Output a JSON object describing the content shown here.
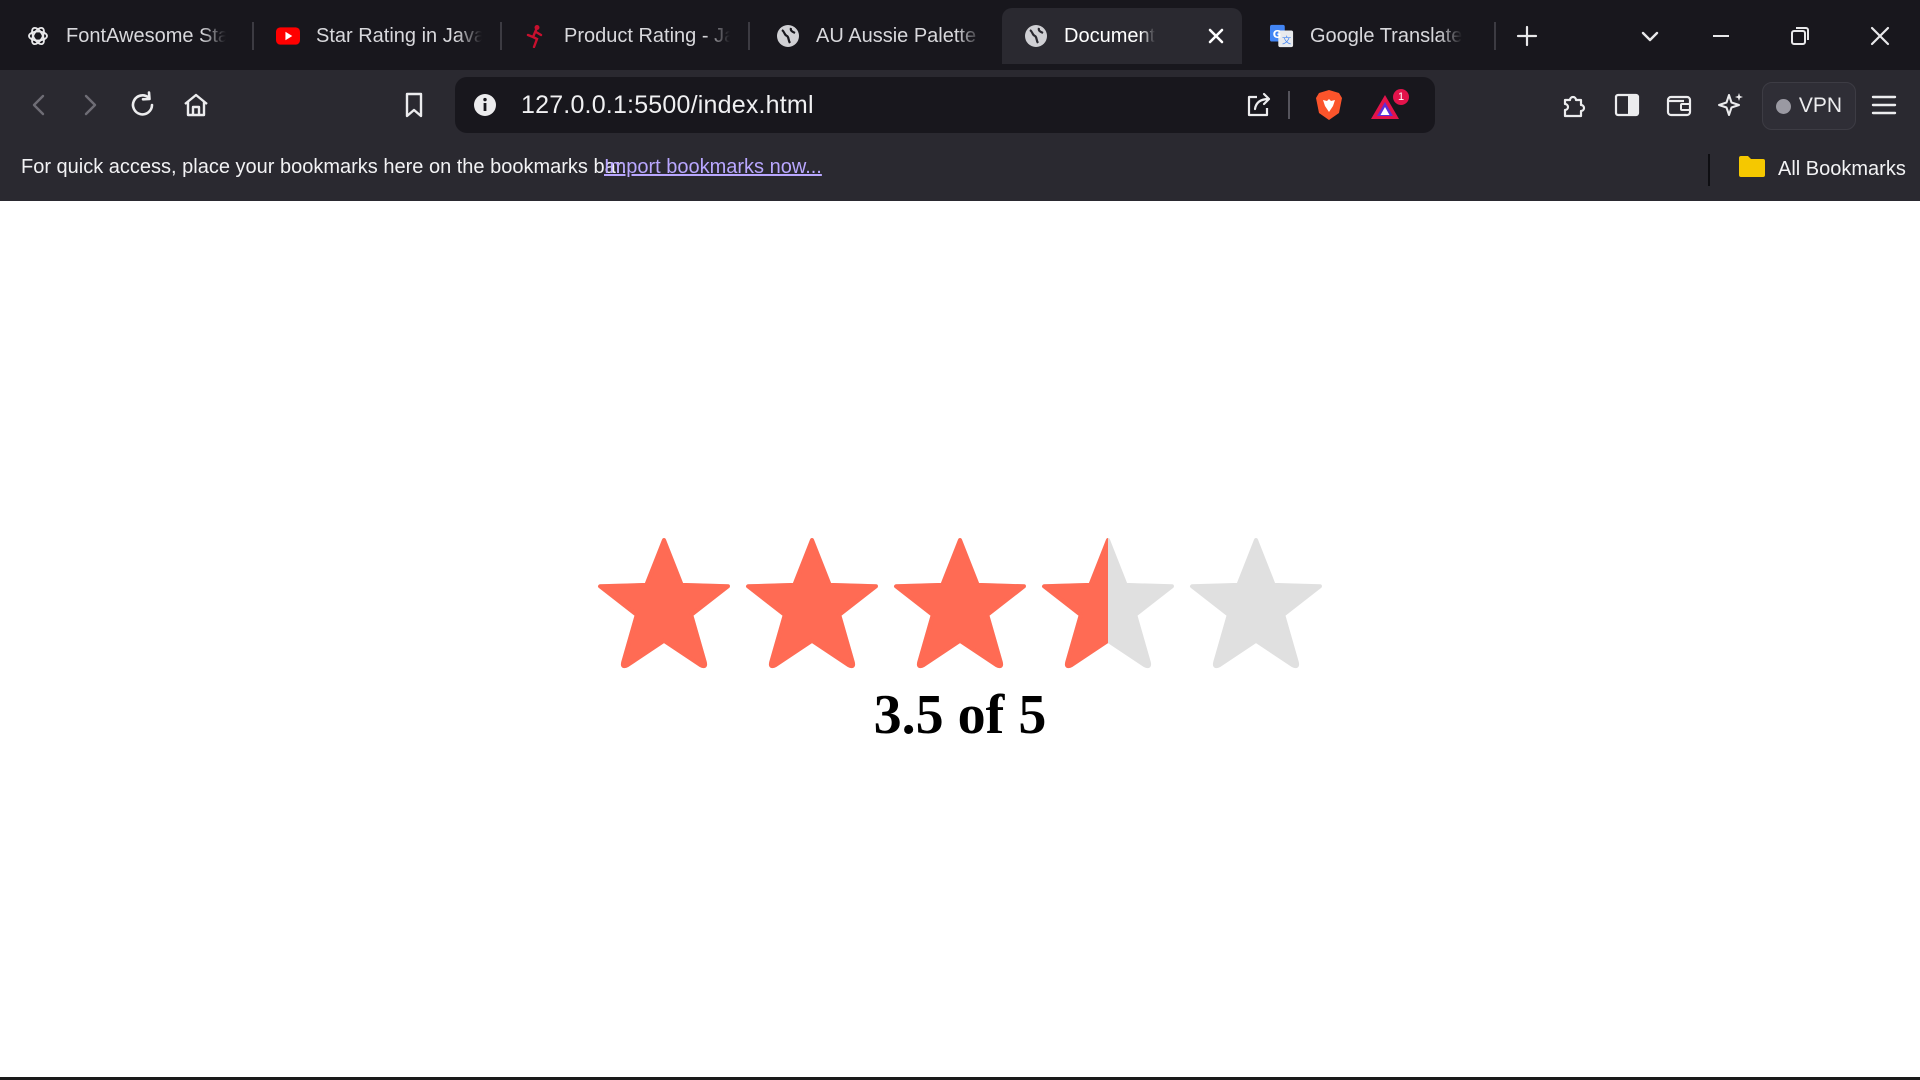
{
  "tabs": [
    {
      "title": "FontAwesome Star",
      "icon": "chatgpt-icon",
      "active": false
    },
    {
      "title": "Star Rating in JavaS",
      "icon": "youtube-icon",
      "active": false
    },
    {
      "title": "Product Rating - Ja",
      "icon": "runner-icon",
      "active": false
    },
    {
      "title": "AU Aussie Palette | F",
      "icon": "globe-icon",
      "active": false
    },
    {
      "title": "Document",
      "icon": "globe-icon",
      "active": true
    },
    {
      "title": "Google Translate",
      "icon": "google-translate-icon",
      "active": false
    }
  ],
  "address_bar": {
    "url": "127.0.0.1:5500/index.html",
    "rewards_badge": "1"
  },
  "vpn_label": "VPN",
  "bookmarks_bar": {
    "message": "For quick access, place your bookmarks here on the bookmarks bar.",
    "import_link": "Import bookmarks now...",
    "all_bookmarks": "All Bookmarks"
  },
  "rating": {
    "value": 3.5,
    "max": 5,
    "text": "3.5 of 5",
    "filled_color": "#ff6b54",
    "empty_color": "#e0e0e0"
  },
  "colors": {
    "chrome_dark": "#18171d",
    "chrome_mid": "#2a2930",
    "link": "#b9a7ff",
    "brave_orange": "#fb542b"
  }
}
